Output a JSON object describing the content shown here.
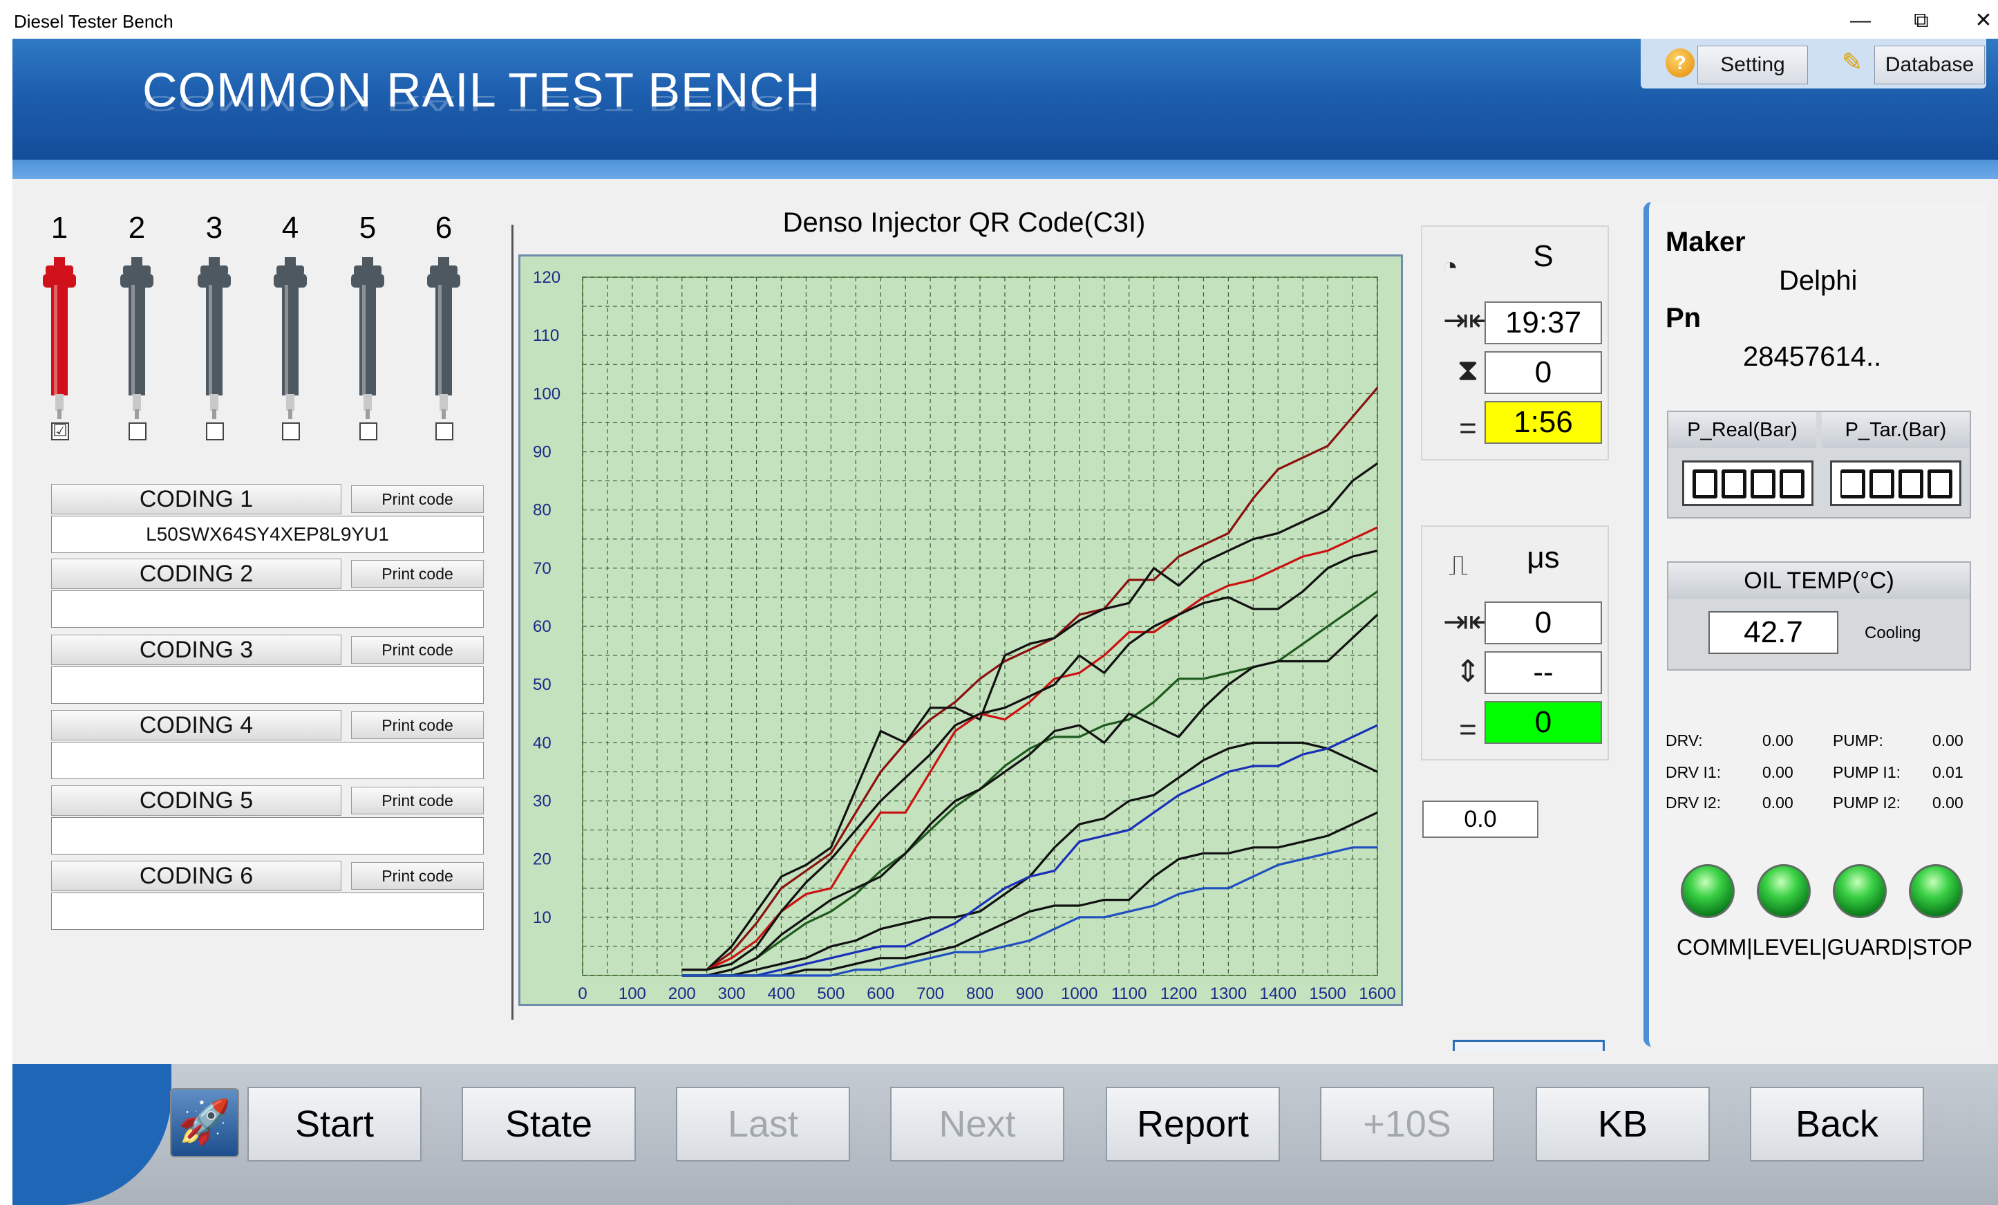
{
  "window": {
    "title": "Diesel Tester Bench",
    "minimize": "—",
    "restore": "⧉",
    "close": "✕"
  },
  "header": {
    "title": "COMMON RAIL TEST BENCH",
    "help_icon": "?",
    "setting_label": "Setting",
    "database_label": "Database"
  },
  "injectors": [
    {
      "number": "1",
      "checked": "☑",
      "color": "#d0101b"
    },
    {
      "number": "2",
      "checked": "",
      "color": "#4e5860"
    },
    {
      "number": "3",
      "checked": "",
      "color": "#4e5860"
    },
    {
      "number": "4",
      "checked": "",
      "color": "#4e5860"
    },
    {
      "number": "5",
      "checked": "",
      "color": "#4e5860"
    },
    {
      "number": "6",
      "checked": "",
      "color": "#4e5860"
    }
  ],
  "coding": [
    {
      "label": "CODING 1",
      "print": "Print code",
      "value": "L50SWX64SY4XEP8L9YU1"
    },
    {
      "label": "CODING 2",
      "print": "Print code",
      "value": ""
    },
    {
      "label": "CODING 3",
      "print": "Print code",
      "value": ""
    },
    {
      "label": "CODING 4",
      "print": "Print code",
      "value": ""
    },
    {
      "label": "CODING 5",
      "print": "Print code",
      "value": ""
    },
    {
      "label": "CODING 6",
      "print": "Print code",
      "value": ""
    }
  ],
  "chart_data": {
    "type": "line",
    "title": "Denso Injector QR Code(C3I)",
    "xlabel": "",
    "ylabel": "",
    "xlim": [
      0,
      1600
    ],
    "ylim": [
      0,
      120
    ],
    "x_ticks": [
      0,
      100,
      200,
      300,
      400,
      500,
      600,
      700,
      800,
      900,
      1000,
      1100,
      1200,
      1300,
      1400,
      1500,
      1600
    ],
    "y_ticks": [
      10,
      20,
      30,
      40,
      50,
      60,
      70,
      80,
      90,
      100,
      110,
      120
    ],
    "grid": true,
    "background": "#c3e2bd",
    "series": [
      {
        "color": "#8b1010",
        "x": [
          200,
          250,
          300,
          350,
          400,
          450,
          500,
          550,
          600,
          650,
          700,
          750,
          800,
          850,
          900,
          950,
          1000,
          1050,
          1100,
          1150,
          1200,
          1250,
          1300,
          1350,
          1400,
          1450,
          1500,
          1550,
          1600
        ],
        "y": [
          1,
          1,
          4,
          9,
          15,
          18,
          21,
          28,
          35,
          40,
          44,
          47,
          51,
          54,
          56,
          58,
          62,
          63,
          68,
          68,
          72,
          74,
          76,
          82,
          87,
          89,
          91,
          96,
          101
        ]
      },
      {
        "color": "#111111",
        "x": [
          200,
          250,
          300,
          350,
          400,
          450,
          500,
          550,
          600,
          650,
          700,
          750,
          800,
          850,
          900,
          950,
          1000,
          1050,
          1100,
          1150,
          1200,
          1250,
          1300,
          1350,
          1400,
          1450,
          1500,
          1550,
          1600
        ],
        "y": [
          1,
          1,
          5,
          11,
          17,
          19,
          22,
          32,
          42,
          40,
          46,
          46,
          44,
          55,
          57,
          58,
          61,
          63,
          64,
          70,
          67,
          71,
          73,
          75,
          76,
          78,
          80,
          85,
          88
        ]
      },
      {
        "color": "#cc1111",
        "x": [
          200,
          250,
          300,
          350,
          400,
          450,
          500,
          550,
          600,
          650,
          700,
          750,
          800,
          850,
          900,
          950,
          1000,
          1050,
          1100,
          1150,
          1200,
          1250,
          1300,
          1350,
          1400,
          1450,
          1500,
          1550,
          1600
        ],
        "y": [
          1,
          1,
          3,
          6,
          11,
          14,
          15,
          22,
          28,
          28,
          35,
          42,
          45,
          44,
          47,
          51,
          52,
          55,
          59,
          59,
          62,
          65,
          67,
          68,
          70,
          72,
          73,
          75,
          77
        ]
      },
      {
        "color": "#111111",
        "x": [
          200,
          250,
          300,
          350,
          400,
          450,
          500,
          550,
          600,
          650,
          700,
          750,
          800,
          850,
          900,
          950,
          1000,
          1050,
          1100,
          1150,
          1200,
          1250,
          1300,
          1350,
          1400,
          1450,
          1500,
          1550,
          1600
        ],
        "y": [
          1,
          1,
          2,
          5,
          11,
          16,
          20,
          25,
          30,
          34,
          38,
          43,
          45,
          46,
          48,
          50,
          55,
          52,
          57,
          60,
          62,
          64,
          65,
          63,
          63,
          66,
          70,
          72,
          73
        ]
      },
      {
        "color": "#1e5a1e",
        "x": [
          200,
          250,
          300,
          350,
          400,
          450,
          500,
          550,
          600,
          650,
          700,
          750,
          800,
          850,
          900,
          950,
          1000,
          1050,
          1100,
          1150,
          1200,
          1250,
          1300,
          1350,
          1400,
          1450,
          1500,
          1550,
          1600
        ],
        "y": [
          0,
          0,
          1,
          3,
          6,
          9,
          11,
          14,
          18,
          21,
          25,
          29,
          32,
          36,
          39,
          41,
          41,
          43,
          44,
          47,
          51,
          51,
          52,
          53,
          54,
          57,
          60,
          63,
          66
        ]
      },
      {
        "color": "#111111",
        "x": [
          200,
          250,
          300,
          350,
          400,
          450,
          500,
          550,
          600,
          650,
          700,
          750,
          800,
          850,
          900,
          950,
          1000,
          1050,
          1100,
          1150,
          1200,
          1250,
          1300,
          1350,
          1400,
          1450,
          1500,
          1550,
          1600
        ],
        "y": [
          0,
          0,
          1,
          3,
          7,
          10,
          13,
          15,
          17,
          21,
          26,
          30,
          32,
          35,
          38,
          42,
          43,
          40,
          45,
          43,
          41,
          46,
          50,
          53,
          54,
          54,
          54,
          58,
          62
        ]
      },
      {
        "color": "#111111",
        "x": [
          200,
          250,
          300,
          350,
          400,
          450,
          500,
          550,
          600,
          650,
          700,
          750,
          800,
          850,
          900,
          950,
          1000,
          1050,
          1100,
          1150,
          1200,
          1250,
          1300,
          1350,
          1400,
          1450,
          1500,
          1550,
          1600
        ],
        "y": [
          0,
          0,
          0,
          1,
          2,
          3,
          5,
          6,
          8,
          9,
          10,
          10,
          11,
          14,
          17,
          22,
          26,
          27,
          30,
          31,
          34,
          37,
          39,
          40,
          40,
          40,
          39,
          37,
          35
        ]
      },
      {
        "color": "#1a2fb8",
        "x": [
          200,
          250,
          300,
          350,
          400,
          450,
          500,
          550,
          600,
          650,
          700,
          750,
          800,
          850,
          900,
          950,
          1000,
          1050,
          1100,
          1150,
          1200,
          1250,
          1300,
          1350,
          1400,
          1450,
          1500,
          1550,
          1600
        ],
        "y": [
          0,
          0,
          0,
          0,
          1,
          2,
          3,
          4,
          5,
          5,
          7,
          9,
          12,
          15,
          17,
          18,
          23,
          24,
          25,
          28,
          31,
          33,
          35,
          36,
          36,
          38,
          39,
          41,
          43
        ]
      },
      {
        "color": "#111111",
        "x": [
          200,
          250,
          300,
          350,
          400,
          450,
          500,
          550,
          600,
          650,
          700,
          750,
          800,
          850,
          900,
          950,
          1000,
          1050,
          1100,
          1150,
          1200,
          1250,
          1300,
          1350,
          1400,
          1450,
          1500,
          1550,
          1600
        ],
        "y": [
          0,
          0,
          0,
          0,
          0,
          1,
          1,
          2,
          3,
          3,
          4,
          5,
          7,
          9,
          11,
          12,
          12,
          13,
          13,
          17,
          20,
          21,
          21,
          22,
          22,
          23,
          24,
          26,
          28
        ]
      },
      {
        "color": "#1f4fc0",
        "x": [
          200,
          250,
          300,
          350,
          400,
          450,
          500,
          550,
          600,
          650,
          700,
          750,
          800,
          850,
          900,
          950,
          1000,
          1050,
          1100,
          1150,
          1200,
          1250,
          1300,
          1350,
          1400,
          1450,
          1500,
          1550,
          1600
        ],
        "y": [
          0,
          0,
          0,
          0,
          0,
          0,
          0,
          1,
          1,
          2,
          3,
          4,
          4,
          5,
          6,
          8,
          10,
          10,
          11,
          12,
          14,
          15,
          15,
          17,
          19,
          20,
          21,
          22,
          22
        ]
      }
    ]
  },
  "timer": {
    "unit": "S",
    "set_value": "19:37",
    "mid_value": "0",
    "current_value": "1:56",
    "current_color": "#ffff00"
  },
  "pulse": {
    "unit": "μs",
    "set_value": "0",
    "mid_value": "--",
    "current_value": "0",
    "current_color": "#00ff00"
  },
  "extra_value": "0.0",
  "maker": {
    "maker_label": "Maker",
    "maker_value": "Delphi",
    "pn_label": "Pn",
    "pn_value": "28457614.."
  },
  "pressure": {
    "real_label": "P_Real(Bar)",
    "target_label": "P_Tar.(Bar)"
  },
  "oil": {
    "label": "OIL TEMP(°C)",
    "value": "42.7",
    "mode": "Cooling"
  },
  "status": {
    "drv_label": "DRV:",
    "drv_value": "0.00",
    "drv_i1_label": "DRV I1:",
    "drv_i1_value": "0.00",
    "drv_i2_label": "DRV I2:",
    "drv_i2_value": "0.00",
    "pump_label": "PUMP:",
    "pump_value": "0.00",
    "pump_i1_label": "PUMP I1:",
    "pump_i1_value": "0.01",
    "pump_i2_label": "PUMP I2:",
    "pump_i2_value": "0.00"
  },
  "leds": {
    "labels": "COMM|LEVEL|GUARD|STOP",
    "color": "#2ecc40"
  },
  "bottom_buttons": {
    "start": "Start",
    "state": "State",
    "last": "Last",
    "next": "Next",
    "report": "Report",
    "plus10": "+10S",
    "kb": "KB",
    "back": "Back"
  }
}
